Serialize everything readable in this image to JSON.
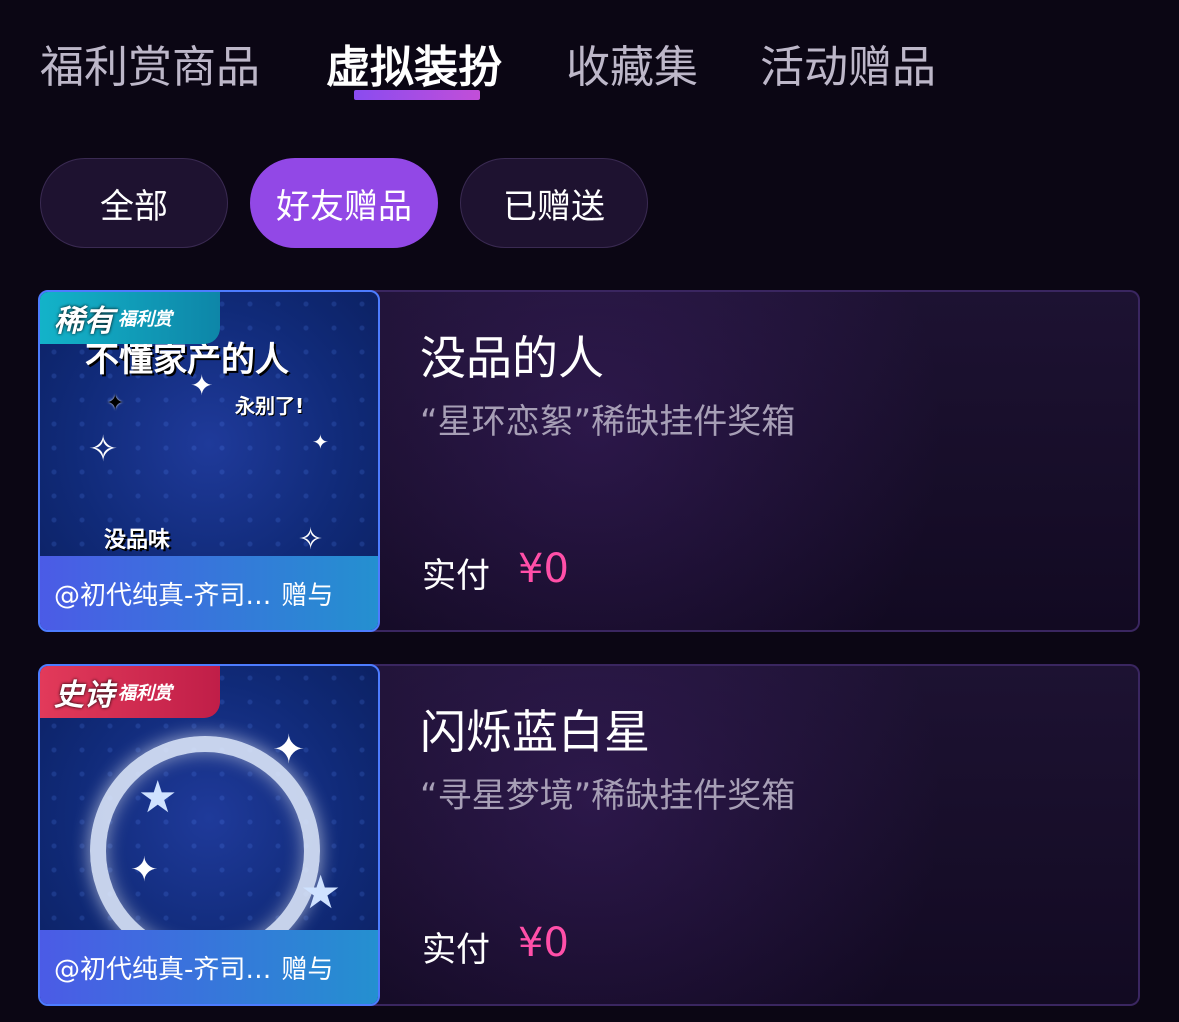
{
  "tabs": [
    {
      "label": "福利赏商品",
      "active": false
    },
    {
      "label": "虚拟装扮",
      "active": true
    },
    {
      "label": "收藏集",
      "active": false
    },
    {
      "label": "活动赠品",
      "active": false
    }
  ],
  "filters": [
    {
      "label": "全部",
      "active": false
    },
    {
      "label": "好友赠品",
      "active": true
    },
    {
      "label": "已赠送",
      "active": false
    }
  ],
  "items": [
    {
      "rarity": "稀有",
      "rarity_tag": "福利赏",
      "thumb_texts": [
        "不懂家产的人",
        "永别了!",
        "没品味"
      ],
      "giver": "@初代纯真-齐司…",
      "gift_label": "赠与",
      "title": "没品的人",
      "subtitle": "“星环恋絮”稀缺挂件奖箱",
      "price_label": "实付",
      "price": "¥0"
    },
    {
      "rarity": "史诗",
      "rarity_tag": "福利赏",
      "giver": "@初代纯真-齐司…",
      "gift_label": "赠与",
      "title": "闪烁蓝白星",
      "subtitle": "“寻星梦境”稀缺挂件奖箱",
      "price_label": "实付",
      "price": "¥0"
    }
  ],
  "colors": {
    "background": "#0b0614",
    "accent_purple": "#9248e6",
    "price_pink": "#ff4fa8",
    "rare_badge": "#13b3c9",
    "epic_badge": "#e23a5a"
  }
}
